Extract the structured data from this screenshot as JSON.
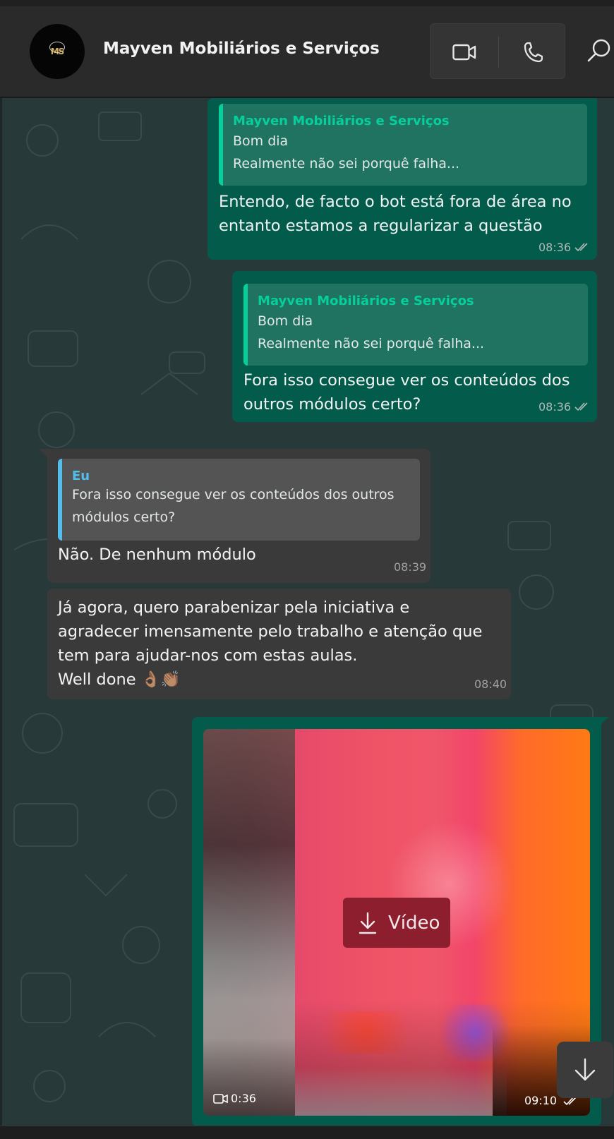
{
  "header": {
    "contact_name": "Mayven Mobiliários e Serviços",
    "avatar_text": "MS",
    "video_call_icon": "video-camera-icon",
    "voice_call_icon": "phone-icon",
    "search_icon": "search-icon"
  },
  "colors": {
    "outgoing_bubble": "#035c4b",
    "incoming_bubble": "#3a3a3a",
    "quote_accent_out": "#06cf9c",
    "quote_accent_in": "#53bdeb",
    "chat_background": "#28393a"
  },
  "messages": [
    {
      "direction": "outgoing",
      "quote": {
        "author": "Mayven Mobiliários e Serviços",
        "line1": "Bom dia",
        "line2": "Realmente não sei porquê falha..."
      },
      "line1": "Entendo, de facto o bot está fora de área no",
      "line2": "entanto estamos a regularizar a questão",
      "time": "08:36",
      "status": "read"
    },
    {
      "direction": "outgoing",
      "quote": {
        "author": "Mayven Mobiliários e Serviços",
        "line1": "Bom dia",
        "line2": "Realmente não sei porquê falha..."
      },
      "line1": "Fora isso consegue ver os conteúdos dos",
      "line2": "outros módulos certo?",
      "time": "08:36",
      "status": "read"
    },
    {
      "direction": "incoming",
      "quote": {
        "author": "Eu",
        "line1": "Fora isso consegue ver os conteúdos dos outros",
        "line2": "módulos certo?"
      },
      "line1": "Não. De nenhum módulo",
      "time": "08:39"
    },
    {
      "direction": "incoming",
      "line1": "Já agora, quero parabenizar pela iniciativa e",
      "line2": "agradecer imensamente pelo trabalho e atenção que",
      "line3": "tem para ajudar-nos com estas aulas.",
      "line4": "Well done 👌🏽👏🏽",
      "time": "08:40"
    },
    {
      "direction": "outgoing",
      "type": "video",
      "download_label": "Vídeo",
      "duration": "0:36",
      "time": "09:10",
      "status": "read"
    }
  ],
  "scroll_down_icon": "arrow-down-icon"
}
